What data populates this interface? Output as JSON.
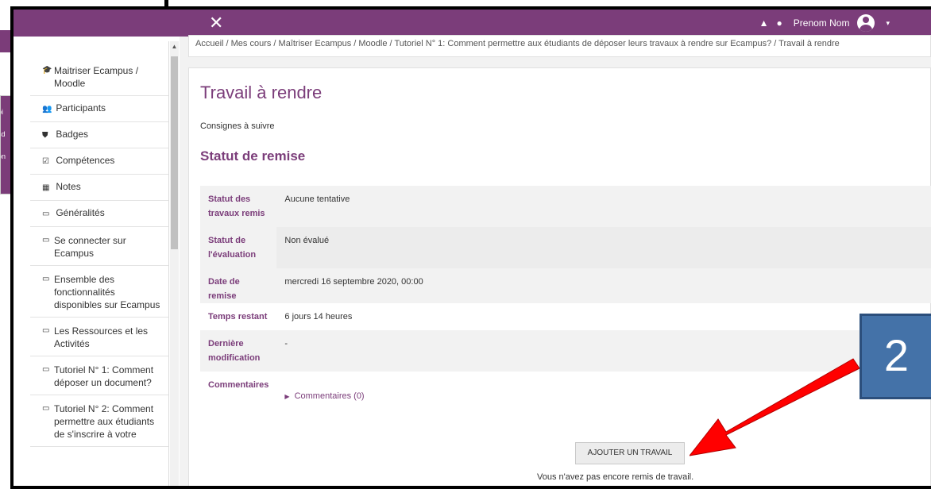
{
  "underlay": {
    "snippet_lines": [
      "pi",
      "sd",
      "on"
    ]
  },
  "navbar": {
    "close_glyph": "✕",
    "bell_glyph": "▲",
    "chat_glyph": "●",
    "user_name": "Prenom Nom",
    "caret_glyph": "▾"
  },
  "breadcrumb": {
    "text": "Accueil / Mes cours / Maîtriser Ecampus / Moodle / Tutoriel N° 1: Comment permettre aux étudiants de déposer leurs travaux à rendre sur Ecampus? / Travail à rendre"
  },
  "sidebar": {
    "items": [
      {
        "icon": "graduation-cap-icon",
        "glyph": "🎓",
        "label": "Maitriser Ecampus / Moodle"
      },
      {
        "icon": "users-icon",
        "glyph": "👥",
        "label": "Participants"
      },
      {
        "icon": "shield-icon",
        "glyph": "⛊",
        "label": "Badges"
      },
      {
        "icon": "check-square-icon",
        "glyph": "☑",
        "label": "Compétences"
      },
      {
        "icon": "table-icon",
        "glyph": "▦",
        "label": "Notes"
      },
      {
        "icon": "folder-icon",
        "glyph": "▭",
        "label": "Généralités"
      },
      {
        "icon": "folder-icon",
        "glyph": "▭",
        "label": "Se connecter sur Ecampus"
      },
      {
        "icon": "folder-icon",
        "glyph": "▭",
        "label": "Ensemble des fonctionnalités disponibles sur Ecampus"
      },
      {
        "icon": "folder-icon",
        "glyph": "▭",
        "label": "Les Ressources et les Activités"
      },
      {
        "icon": "folder-icon",
        "glyph": "▭",
        "label": "Tutoriel N° 1: Comment déposer un document?"
      },
      {
        "icon": "folder-icon",
        "glyph": "▭",
        "label": "Tutoriel N° 2: Comment permettre aux étudiants de s'inscrire à votre"
      }
    ],
    "scroll_up": "▲",
    "scroll_down": "▼"
  },
  "main": {
    "title": "Travail à rendre",
    "instructions": "Consignes à suivre",
    "section_title": "Statut de remise",
    "rows": [
      {
        "label": "Statut des travaux remis",
        "value": "Aucune tentative"
      },
      {
        "label": "Statut de l'évaluation",
        "value": "Non évalué"
      },
      {
        "label": "Date de remise",
        "value": "mercredi 16 septembre 2020, 00:00"
      },
      {
        "label": "Temps restant",
        "value": "6 jours 14 heures"
      },
      {
        "label": "Dernière modification",
        "value": "-"
      },
      {
        "label": "Commentaires",
        "value": "Commentaires (0)"
      }
    ],
    "comment_toggle_glyph": "▶",
    "add_button": "AJOUTER UN TRAVAIL",
    "footer_note": "Vous n'avez pas encore remis de travail."
  },
  "annotation": {
    "number": "2",
    "arrow_color": "#ff0000",
    "badge_color": "#4472a8"
  },
  "colors": {
    "brand": "#7b3d7a",
    "accent_text": "#7b3d7a"
  }
}
